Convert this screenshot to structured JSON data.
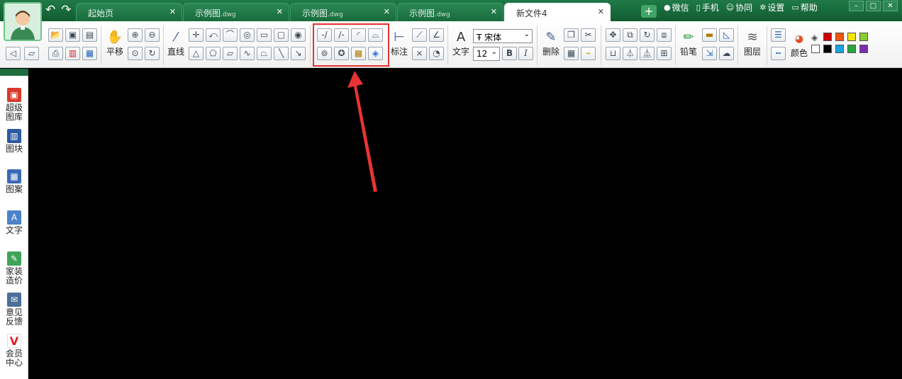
{
  "titlebar": {
    "tabs": [
      {
        "label": "起始页",
        "sub": ""
      },
      {
        "label": "示例图",
        "sub": ".dwg"
      },
      {
        "label": "示例图",
        "sub": ".dwg"
      },
      {
        "label": "示例图",
        "sub": ".dwg"
      },
      {
        "label": "新文件4",
        "sub": ""
      }
    ],
    "add_tab": "+",
    "links": {
      "wechat": "微信",
      "phone": "手机",
      "collab": "协同",
      "settings": "设置",
      "help": "帮助"
    }
  },
  "toolbar": {
    "pan": "平移",
    "line": "直线",
    "dimension": "标注",
    "text": "文字",
    "font": "宋体",
    "font_size": "12",
    "bold": "B",
    "italic": "I",
    "delete": "删除",
    "pencil": "铅笔",
    "layer": "图层",
    "color": "颜色",
    "swatches_top": [
      "#cc0000",
      "#ee5511",
      "#f5e400",
      "#88cc33"
    ],
    "swatches_bottom": [
      "#ffffff",
      "#000000",
      "#1aa3e0",
      "#27a83a",
      "#7a2bb0"
    ],
    "highlight_color": "#e53333"
  },
  "sidebar": {
    "items": [
      {
        "line1": "超级",
        "line2": "图库"
      },
      {
        "line1": "图块",
        "line2": ""
      },
      {
        "line1": "图案",
        "line2": ""
      },
      {
        "line1": "文字",
        "line2": ""
      },
      {
        "line1": "家装",
        "line2": "造价"
      },
      {
        "line1": "意见",
        "line2": "反馈"
      },
      {
        "line1": "会员",
        "line2": "中心"
      }
    ]
  }
}
